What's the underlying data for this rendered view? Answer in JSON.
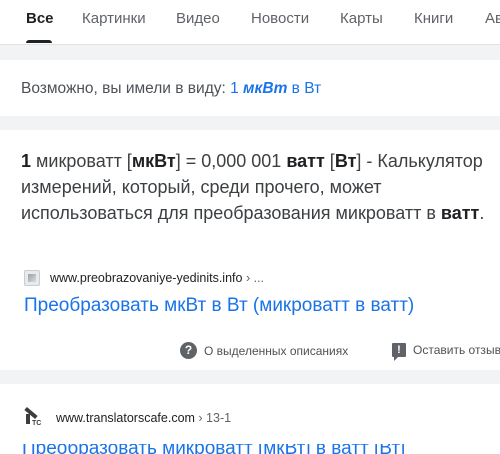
{
  "tabs": [
    {
      "label": "Все",
      "active": true
    },
    {
      "label": "Картинки"
    },
    {
      "label": "Видео"
    },
    {
      "label": "Новости"
    },
    {
      "label": "Карты"
    },
    {
      "label": "Книги"
    },
    {
      "label": "Ав"
    }
  ],
  "did_you_mean": {
    "prefix": "Возможно, вы имели в виду: ",
    "q_num": "1",
    "q_bold": "мкВт",
    "q_rest": "в Вт"
  },
  "result1": {
    "snippet_num": "1",
    "snippet_a": " микроватт [",
    "snippet_b1": "мкВт",
    "snippet_c": "] = 0,000 001 ",
    "snippet_b2": "ватт",
    "snippet_d": " [",
    "snippet_b3": "Вт",
    "snippet_e": "] - Калькулятор измерений, который, среди прочего, может использоваться для преобразования микроватт в ",
    "snippet_b4": "ватт",
    "snippet_f": ".",
    "source_url": "www.preobrazovaniye-yedinits.info",
    "source_ellipsis": " › ...",
    "title": "Преобразовать мкВт в Вт (микроватт в ватт)",
    "feedback_about": "О выделенных описаниях",
    "feedback_report": "Оставить отзыв",
    "feedback_icon": "question-icon",
    "report_icon": "flag-icon"
  },
  "result2": {
    "source_url": "www.translatorscafe.com",
    "source_crumb": " › 13-1",
    "title_partial": "Преобразовать микроватт [мкВт] в ватт [Вт]",
    "icon_text": "TC"
  },
  "colors": {
    "link": "#1a73e8",
    "text": "#202124",
    "secondary": "#4d5156",
    "background": "#f1f3f4"
  }
}
